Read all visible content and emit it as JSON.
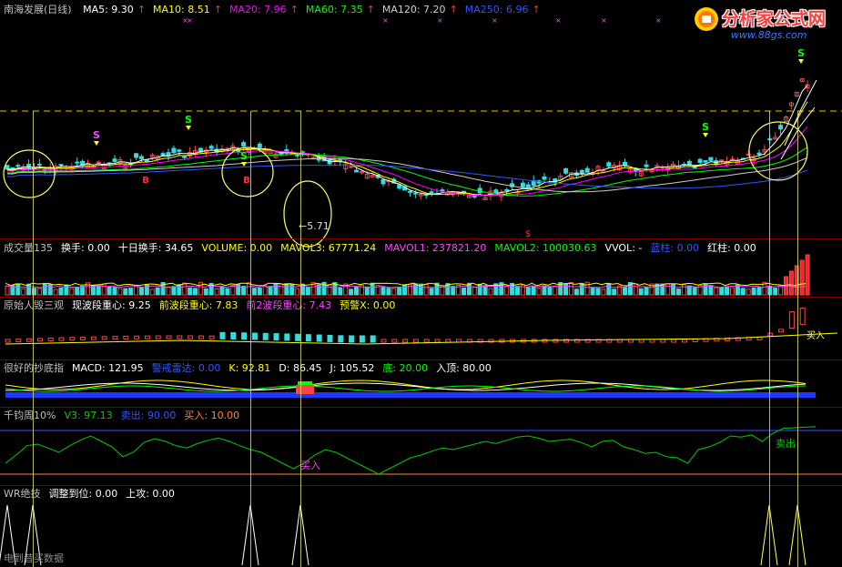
{
  "header": {
    "stock": "南海发展(日线)",
    "ma": [
      {
        "label": "MA5: 9.30",
        "color": "#ffffff"
      },
      {
        "label": "MA10: 8.51",
        "color": "#ffff00"
      },
      {
        "label": "MA20: 7.96",
        "color": "#ff00ff"
      },
      {
        "label": "MA60: 7.35",
        "color": "#00ff00"
      },
      {
        "label": "MA120: 7.20",
        "color": "#d0d0d0"
      },
      {
        "label": "MA250: 6.96",
        "color": "#3355ff"
      }
    ]
  },
  "logo": {
    "main": "分析家公式网",
    "sub": "www.88gs.com"
  },
  "panels": {
    "vol": {
      "items": [
        {
          "label": "成交量135",
          "color": "#c0c0c0"
        },
        {
          "label": "换手: 0.00",
          "color": "#ffffff"
        },
        {
          "label": "十日换手: 34.65",
          "color": "#ffffff"
        },
        {
          "label": "VOLUME: 0.00",
          "color": "#ffff00"
        },
        {
          "label": "MAVOL3: 67771.24",
          "color": "#ffff00"
        },
        {
          "label": "MAVOL1: 237821.20",
          "color": "#ff44ff"
        },
        {
          "label": "MAVOL2: 100030.63",
          "color": "#00ff00"
        },
        {
          "label": "VVOL: -",
          "color": "#ffffff"
        },
        {
          "label": "蓝柱: 0.00",
          "color": "#3355ff"
        },
        {
          "label": "红柱: 0.00",
          "color": "#ffffff"
        }
      ]
    },
    "center": {
      "items": [
        {
          "label": "原始人毁三观",
          "color": "#c0c0c0"
        },
        {
          "label": "现波段重心: 9.25",
          "color": "#ffffff"
        },
        {
          "label": "前波段重心: 7.83",
          "color": "#ffff00"
        },
        {
          "label": "前2波段重心: 7.43",
          "color": "#ff44ff"
        },
        {
          "label": "预警X: 0.00",
          "color": "#ffff00"
        }
      ],
      "annot": "买入"
    },
    "macd": {
      "items": [
        {
          "label": "很好的抄底指",
          "color": "#c0c0c0"
        },
        {
          "label": "MACD: 121.95",
          "color": "#ffffff"
        },
        {
          "label": "警戒雷达: 0.00",
          "color": "#3355ff"
        },
        {
          "label": "K: 92.81",
          "color": "#ffff00"
        },
        {
          "label": "D: 86.45",
          "color": "#ffffff"
        },
        {
          "label": "J: 105.52",
          "color": "#ffffff"
        },
        {
          "label": "底: 20.00",
          "color": "#00ff00"
        },
        {
          "label": "入顶: 80.00",
          "color": "#ffffff"
        }
      ]
    },
    "v3": {
      "items": [
        {
          "label": "千钧周10%",
          "color": "#c0c0c0"
        },
        {
          "label": "V3: 97.13",
          "color": "#00cc00"
        },
        {
          "label": "卖出: 90.00",
          "color": "#3355ff"
        },
        {
          "label": "买入: 10.00",
          "color": "#ff8844"
        }
      ],
      "buy_text": "买入",
      "sell_text": "卖出"
    },
    "wr": {
      "items": [
        {
          "label": "WR绝技",
          "color": "#c0c0c0"
        },
        {
          "label": "调整到位: 0.00",
          "color": "#ffffff"
        },
        {
          "label": "上攻: 0.00",
          "color": "#ffffff"
        }
      ]
    }
  },
  "annotations": {
    "low_label": "←5.71",
    "s_mark": "S",
    "b_mark": "B",
    "dollar": "$"
  },
  "footer": "电到昔买数据",
  "chart_data": {
    "type": "line",
    "title": "南海发展(日线)",
    "series": [
      {
        "name": "V3",
        "values": [
          30,
          45,
          62,
          65,
          58,
          50,
          62,
          72,
          80,
          70,
          60,
          42,
          50,
          68,
          75,
          70,
          62,
          58,
          66,
          72,
          76,
          70,
          62,
          55,
          50,
          40,
          30,
          20,
          30,
          45,
          55,
          50,
          40,
          30,
          20,
          10,
          20,
          30,
          40,
          45,
          52,
          58,
          55,
          60,
          65,
          70,
          66,
          72,
          78,
          80,
          76,
          70,
          72,
          74,
          68,
          60,
          70,
          72,
          60,
          55,
          48,
          50,
          42,
          40,
          30,
          55,
          60,
          68,
          80,
          78,
          82,
          70,
          85,
          94,
          95,
          96,
          97
        ]
      }
    ],
    "price_range": [
      5.71,
      10.5
    ],
    "low_price": 5.71
  }
}
